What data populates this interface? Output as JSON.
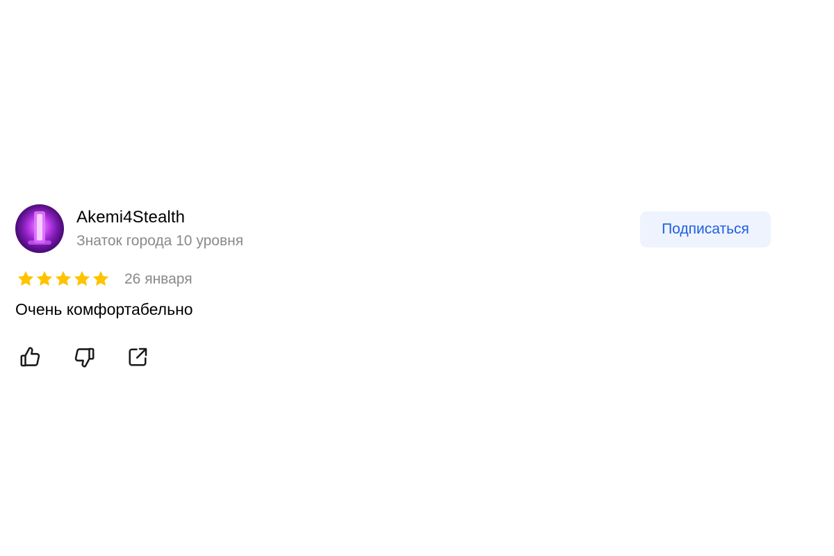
{
  "review": {
    "author": {
      "name": "Akemi4Stealth",
      "level": "Знаток города 10 уровня",
      "avatar_icon": "neon-figure-avatar"
    },
    "subscribe_label": "Подписаться",
    "rating": {
      "value": 5,
      "max": 5,
      "star_color": "#ffc300"
    },
    "date": "26 января",
    "text": "Очень комфортабельно",
    "actions": [
      {
        "icon": "thumbs-up-icon"
      },
      {
        "icon": "thumbs-down-icon"
      },
      {
        "icon": "share-icon"
      }
    ]
  },
  "colors": {
    "accent": "#1f5de0",
    "subscribe_bg": "#eef3fd",
    "muted_text": "#898989"
  }
}
